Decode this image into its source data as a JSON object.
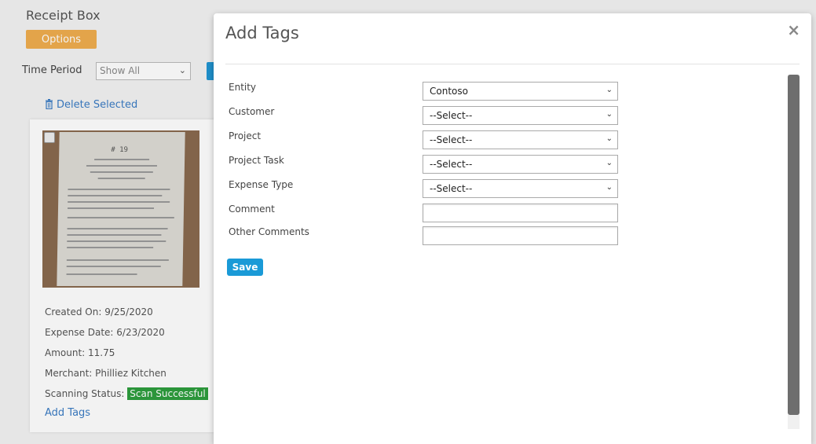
{
  "background": {
    "app_title": "Receipt Box",
    "options_label": "Options",
    "time_period_label": "Time Period",
    "time_period_value": "Show All",
    "delete_selected_label": "Delete Selected",
    "receipt_card": {
      "created_on": "Created On: 9/25/2020",
      "expense_date": "Expense Date: 6/23/2020",
      "amount": "Amount: 11.75",
      "merchant": "Merchant: Philliez Kitchen",
      "scanning_status_label": "Scanning Status:",
      "scanning_status_value": "Scan Successful",
      "add_tags_label": "Add Tags",
      "receipt_number": "# 19"
    }
  },
  "modal": {
    "title": "Add Tags",
    "close_glyph": "×",
    "fields": {
      "entity": {
        "label": "Entity",
        "value": "Contoso"
      },
      "customer": {
        "label": "Customer",
        "value": "--Select--"
      },
      "project": {
        "label": "Project",
        "value": "--Select--"
      },
      "project_task": {
        "label": "Project Task",
        "value": "--Select--"
      },
      "expense_type": {
        "label": "Expense Type",
        "value": "--Select--"
      },
      "comment": {
        "label": "Comment",
        "value": ""
      },
      "other_comments": {
        "label": "Other Comments",
        "value": ""
      }
    },
    "save_label": "Save"
  },
  "colors": {
    "options_button": "#f0ad4e",
    "save_button": "#1a9ad7",
    "scan_success": "#2e9e3e",
    "link": "#3a7cc4"
  }
}
